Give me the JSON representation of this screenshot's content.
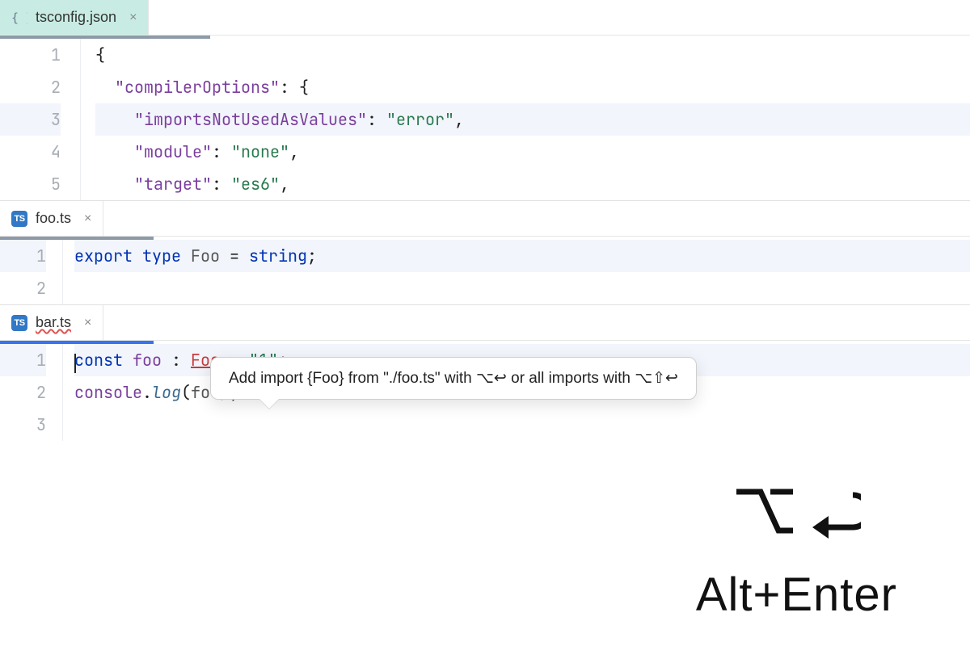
{
  "pane1": {
    "tab": {
      "label": "tsconfig.json"
    },
    "lines": [
      {
        "n": "1"
      },
      {
        "n": "2"
      },
      {
        "n": "3"
      },
      {
        "n": "4"
      },
      {
        "n": "5"
      }
    ],
    "code": {
      "l1_brace": "{",
      "l2_key": "\"compilerOptions\"",
      "l2_rest": ": {",
      "l3_key": "\"importsNotUsedAsValues\"",
      "l3_colon": ": ",
      "l3_val": "\"error\"",
      "l3_comma": ",",
      "l4_key": "\"module\"",
      "l4_colon": ": ",
      "l4_val": "\"none\"",
      "l4_comma": ",",
      "l5_key": "\"target\"",
      "l5_colon": ": ",
      "l5_val": "\"es6\"",
      "l5_comma": ","
    }
  },
  "pane2": {
    "tab": {
      "label": "foo.ts"
    },
    "lines": [
      {
        "n": "1"
      },
      {
        "n": "2"
      }
    ],
    "code": {
      "l1_export": "export",
      "l1_type": " type ",
      "l1_name": "Foo",
      "l1_eq": " = ",
      "l1_str": "string",
      "l1_semi": ";"
    }
  },
  "pane3": {
    "tab": {
      "label": "bar.ts"
    },
    "lines": [
      {
        "n": "1"
      },
      {
        "n": "2"
      },
      {
        "n": "3"
      }
    ],
    "code": {
      "l1_const": "const",
      "l1_var": " foo ",
      "l1_colon": ": ",
      "l1_type": "Foo",
      "l1_eq": " = ",
      "l1_str": "\"1\"",
      "l1_semi": ";",
      "l2_console": "console",
      "l2_dot": ".",
      "l2_log": "log",
      "l2_open": "(",
      "l2_arg": "foo",
      "l2_close": ");"
    }
  },
  "tooltip": {
    "text_pre": "Add import {Foo} from \"./foo.ts\" with ",
    "kbd1": "⌥↩",
    "text_mid": " or all imports with ",
    "kbd2": "⌥⇧↩"
  },
  "shortcut": {
    "symbols": "⌥↩",
    "label": "Alt+Enter"
  },
  "icons": {
    "ts": "TS",
    "json": "{ }",
    "close": "×"
  }
}
